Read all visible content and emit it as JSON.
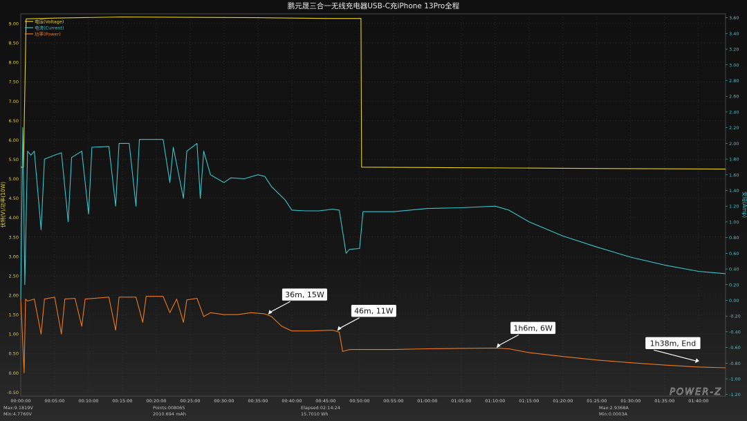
{
  "title": "鹏元晟三合一无线充电器USB-C充iPhone 13Pro全程",
  "watermark": "POWER-Z",
  "colors": {
    "voltage": "#e8d21c",
    "current": "#35c7cf",
    "power": "#ef7a1a",
    "grid": "#3a3a3a",
    "left_axis": "#e8d21c",
    "right_axis": "#35c7cf",
    "callout_text": "#111111",
    "callout_bg": "#ffffff"
  },
  "chart_data": {
    "type": "line",
    "ylabel_left": "伏特(V)/功率(10W)",
    "ylabel_right": "安培(Amp)",
    "left_ylim": [
      -0.6,
      9.25
    ],
    "right_ylim": [
      -1.22,
      3.65
    ],
    "left_ticks": [
      "9.00",
      "8.50",
      "8.00",
      "7.50",
      "7.00",
      "6.50",
      "6.00",
      "5.50",
      "5.00",
      "4.50",
      "4.00",
      "3.50",
      "3.00",
      "2.50",
      "2.00",
      "1.50",
      "1.00",
      "0.50",
      "0.00",
      "-0.50"
    ],
    "right_ticks": [
      "3.60",
      "3.40",
      "3.20",
      "3.00",
      "2.80",
      "2.60",
      "2.40",
      "2.20",
      "2.00",
      "1.80",
      "1.60",
      "1.40",
      "1.20",
      "1.00",
      "0.80",
      "0.60",
      "0.40",
      "0.20",
      "0.00",
      "-0.20",
      "-0.40",
      "-0.60",
      "-0.80",
      "-1.00",
      "-1.20"
    ],
    "x_ticks": [
      "00:00:00",
      "00:05:00",
      "00:10:00",
      "00:15:00",
      "00:20:00",
      "00:25:00",
      "00:30:00",
      "00:35:00",
      "00:40:00",
      "00:45:00",
      "00:50:00",
      "00:55:00",
      "01:00:00",
      "01:05:00",
      "01:10:00",
      "01:15:00",
      "01:20:00",
      "01:25:00",
      "01:30:00",
      "01:35:00",
      "01:40:00"
    ],
    "x_unit": "minutes",
    "x_range": [
      0,
      104
    ],
    "legend": [
      "电压(Voltage)",
      "电流(Current)",
      "功率(Power)"
    ],
    "legend_position": "top-left",
    "series": [
      {
        "name": "电压(Voltage)",
        "axis": "left",
        "points": [
          [
            0,
            5.3
          ],
          [
            0.4,
            5.3
          ],
          [
            0.8,
            9.12
          ],
          [
            5,
            9.14
          ],
          [
            15,
            9.17
          ],
          [
            25,
            9.16
          ],
          [
            35,
            9.15
          ],
          [
            45,
            9.13
          ],
          [
            50.2,
            9.13
          ],
          [
            50.3,
            5.3
          ],
          [
            60,
            5.29
          ],
          [
            80,
            5.27
          ],
          [
            104,
            5.25
          ]
        ]
      },
      {
        "name": "电流(Current)",
        "axis": "right",
        "points": [
          [
            0,
            0
          ],
          [
            0.3,
            2.2
          ],
          [
            0.6,
            0.2
          ],
          [
            1,
            1.9
          ],
          [
            1.5,
            1.85
          ],
          [
            2,
            1.9
          ],
          [
            3,
            0.9
          ],
          [
            3.5,
            1.8
          ],
          [
            5,
            1.85
          ],
          [
            6,
            1.88
          ],
          [
            7,
            1.0
          ],
          [
            7.5,
            1.82
          ],
          [
            9,
            1.9
          ],
          [
            10,
            1.1
          ],
          [
            10.5,
            1.95
          ],
          [
            13,
            1.96
          ],
          [
            14,
            1.2
          ],
          [
            14.5,
            2.0
          ],
          [
            16,
            2.0
          ],
          [
            17,
            1.2
          ],
          [
            17.5,
            2.05
          ],
          [
            21,
            2.05
          ],
          [
            22,
            1.5
          ],
          [
            22.5,
            1.95
          ],
          [
            24,
            1.3
          ],
          [
            24.5,
            1.9
          ],
          [
            26,
            2.0
          ],
          [
            26.5,
            1.3
          ],
          [
            27,
            1.9
          ],
          [
            28,
            1.6
          ],
          [
            29,
            1.55
          ],
          [
            30,
            1.5
          ],
          [
            31,
            1.56
          ],
          [
            33,
            1.55
          ],
          [
            35,
            1.6
          ],
          [
            36,
            1.58
          ],
          [
            37,
            1.45
          ],
          [
            39,
            1.28
          ],
          [
            40,
            1.15
          ],
          [
            42,
            1.14
          ],
          [
            44,
            1.14
          ],
          [
            46,
            1.16
          ],
          [
            47,
            1.15
          ],
          [
            48,
            0.6
          ],
          [
            48.5,
            0.65
          ],
          [
            50,
            0.66
          ],
          [
            50.5,
            1.13
          ],
          [
            55,
            1.13
          ],
          [
            60,
            1.17
          ],
          [
            65,
            1.18
          ],
          [
            70,
            1.2
          ],
          [
            72,
            1.15
          ],
          [
            75,
            1.0
          ],
          [
            80,
            0.82
          ],
          [
            85,
            0.68
          ],
          [
            90,
            0.55
          ],
          [
            95,
            0.45
          ],
          [
            100,
            0.37
          ],
          [
            104,
            0.34
          ]
        ]
      },
      {
        "name": "功率(Power)",
        "axis": "left",
        "points": [
          [
            0,
            1.9
          ],
          [
            0.5,
            0.0
          ],
          [
            0.7,
            1.9
          ],
          [
            1,
            1.85
          ],
          [
            2,
            1.9
          ],
          [
            3,
            1.0
          ],
          [
            3.5,
            1.9
          ],
          [
            5,
            1.95
          ],
          [
            6,
            1.0
          ],
          [
            6.5,
            1.9
          ],
          [
            8,
            1.92
          ],
          [
            9,
            1.2
          ],
          [
            9.5,
            1.9
          ],
          [
            13,
            1.95
          ],
          [
            14,
            1.1
          ],
          [
            14.5,
            1.95
          ],
          [
            17,
            1.95
          ],
          [
            18,
            1.3
          ],
          [
            18.5,
            1.97
          ],
          [
            21,
            1.97
          ],
          [
            22,
            1.55
          ],
          [
            23,
            1.9
          ],
          [
            24,
            1.3
          ],
          [
            24.5,
            1.88
          ],
          [
            26,
            1.92
          ],
          [
            27,
            1.45
          ],
          [
            28,
            1.55
          ],
          [
            30,
            1.5
          ],
          [
            32,
            1.5
          ],
          [
            34,
            1.55
          ],
          [
            36,
            1.52
          ],
          [
            37,
            1.45
          ],
          [
            38.5,
            1.2
          ],
          [
            40,
            1.08
          ],
          [
            43,
            1.08
          ],
          [
            46,
            1.1
          ],
          [
            47,
            1.05
          ],
          [
            47.5,
            0.55
          ],
          [
            48.5,
            0.6
          ],
          [
            50,
            0.6
          ],
          [
            50.5,
            0.6
          ],
          [
            55,
            0.6
          ],
          [
            60,
            0.62
          ],
          [
            65,
            0.63
          ],
          [
            70,
            0.64
          ],
          [
            72,
            0.62
          ],
          [
            75,
            0.52
          ],
          [
            80,
            0.42
          ],
          [
            85,
            0.33
          ],
          [
            90,
            0.26
          ],
          [
            95,
            0.2
          ],
          [
            100,
            0.15
          ],
          [
            104,
            0.13
          ]
        ]
      }
    ],
    "annotations": [
      {
        "text": "36m, 15W",
        "x": 36.5,
        "y": 1.5
      },
      {
        "text": "46m, 11W",
        "x": 46.7,
        "y": 1.08
      },
      {
        "text": "1h6m, 6W",
        "x": 70.2,
        "y": 0.64
      },
      {
        "text": "1h38m, End",
        "x": 99.5,
        "y": 0.25
      }
    ]
  },
  "footer": {
    "col1_line1": "Max:9.1819V",
    "col1_line2": "Min:4.7760V",
    "col2_line1": "Points:008065",
    "col2_line2": "2010.694 mAh",
    "col3_line1": "Elapsed:02:14:24",
    "col3_line2": "15.7010 Wh",
    "col4_line1": "Max:2.9368A",
    "col4_line2": "Min:0.0003A"
  }
}
